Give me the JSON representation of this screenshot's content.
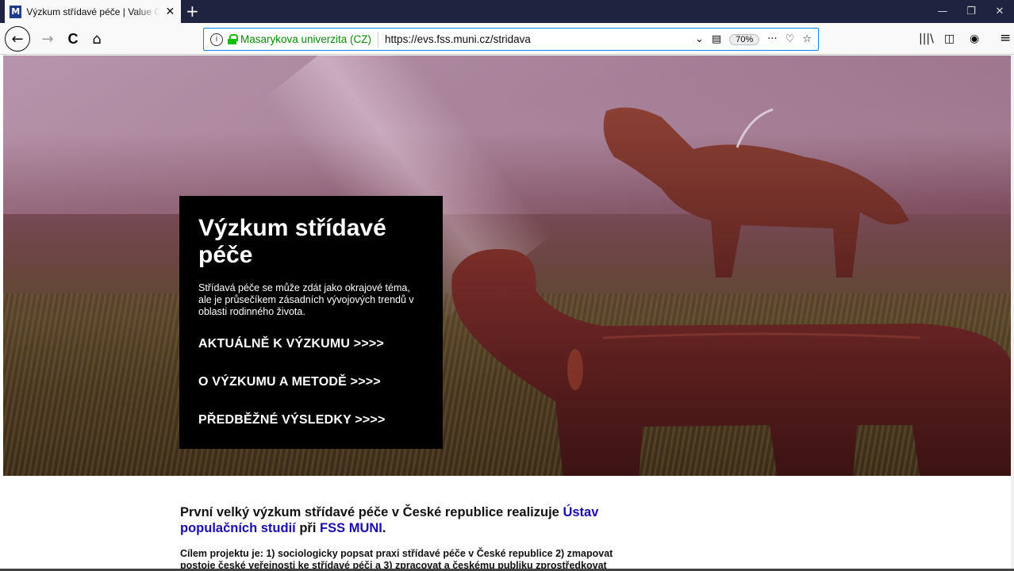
{
  "browser": {
    "tab": {
      "favicon_letter": "M",
      "title": "Výzkum střídavé péče | Value C"
    },
    "new_tab_label": "+",
    "window_controls": [
      "—",
      "❐",
      "✕"
    ],
    "nav": {
      "back": "←",
      "forward": "→",
      "reload": "C",
      "home": "⌂"
    },
    "urlbar": {
      "info": "i",
      "organization": "Masarykova univerzita (CZ)",
      "url": "https://evs.fss.muni.cz/stridava",
      "zoom": "70%",
      "dropdown": "⌄",
      "reader": "▤",
      "more": "···",
      "pocket": "♡",
      "bookmark": "☆"
    },
    "toolbar_right": {
      "library": "|||\\",
      "sidebar": "◫",
      "account": "◉",
      "menu": "≡"
    }
  },
  "hero": {
    "title": "Výzkum střídavé péče",
    "description": "Střídavá péče se může zdát jako okrajové téma, ale je průsečíkem zásadních vývojových trendů v oblasti rodinného života.",
    "links": [
      "AKTUÁLNĚ K VÝZKUMU >>>>",
      "O VÝZKUMU A METODĚ >>>>",
      "PŘEDBĚŽNÉ VÝSLEDKY >>>>"
    ]
  },
  "content": {
    "lead_part1": "První velký výzkum střídavé péče v České republice realizuje ",
    "lead_link1": "Ústav populačních studií",
    "lead_part2": " při ",
    "lead_link2": "FSS MUNI",
    "lead_part3": ".",
    "intro": "Cílem projektu je: 1) sociologicky popsat praxi střídavé péče v České republice 2) zmapovat postoje české veřejnosti ke střídavé péči a 3) zpracovat a českému publiku zprostředkovat"
  },
  "colors": {
    "tabbar": "#202340",
    "secure_green": "#058b00",
    "link_blue": "#1a0dab",
    "hero_box": "#000000"
  }
}
